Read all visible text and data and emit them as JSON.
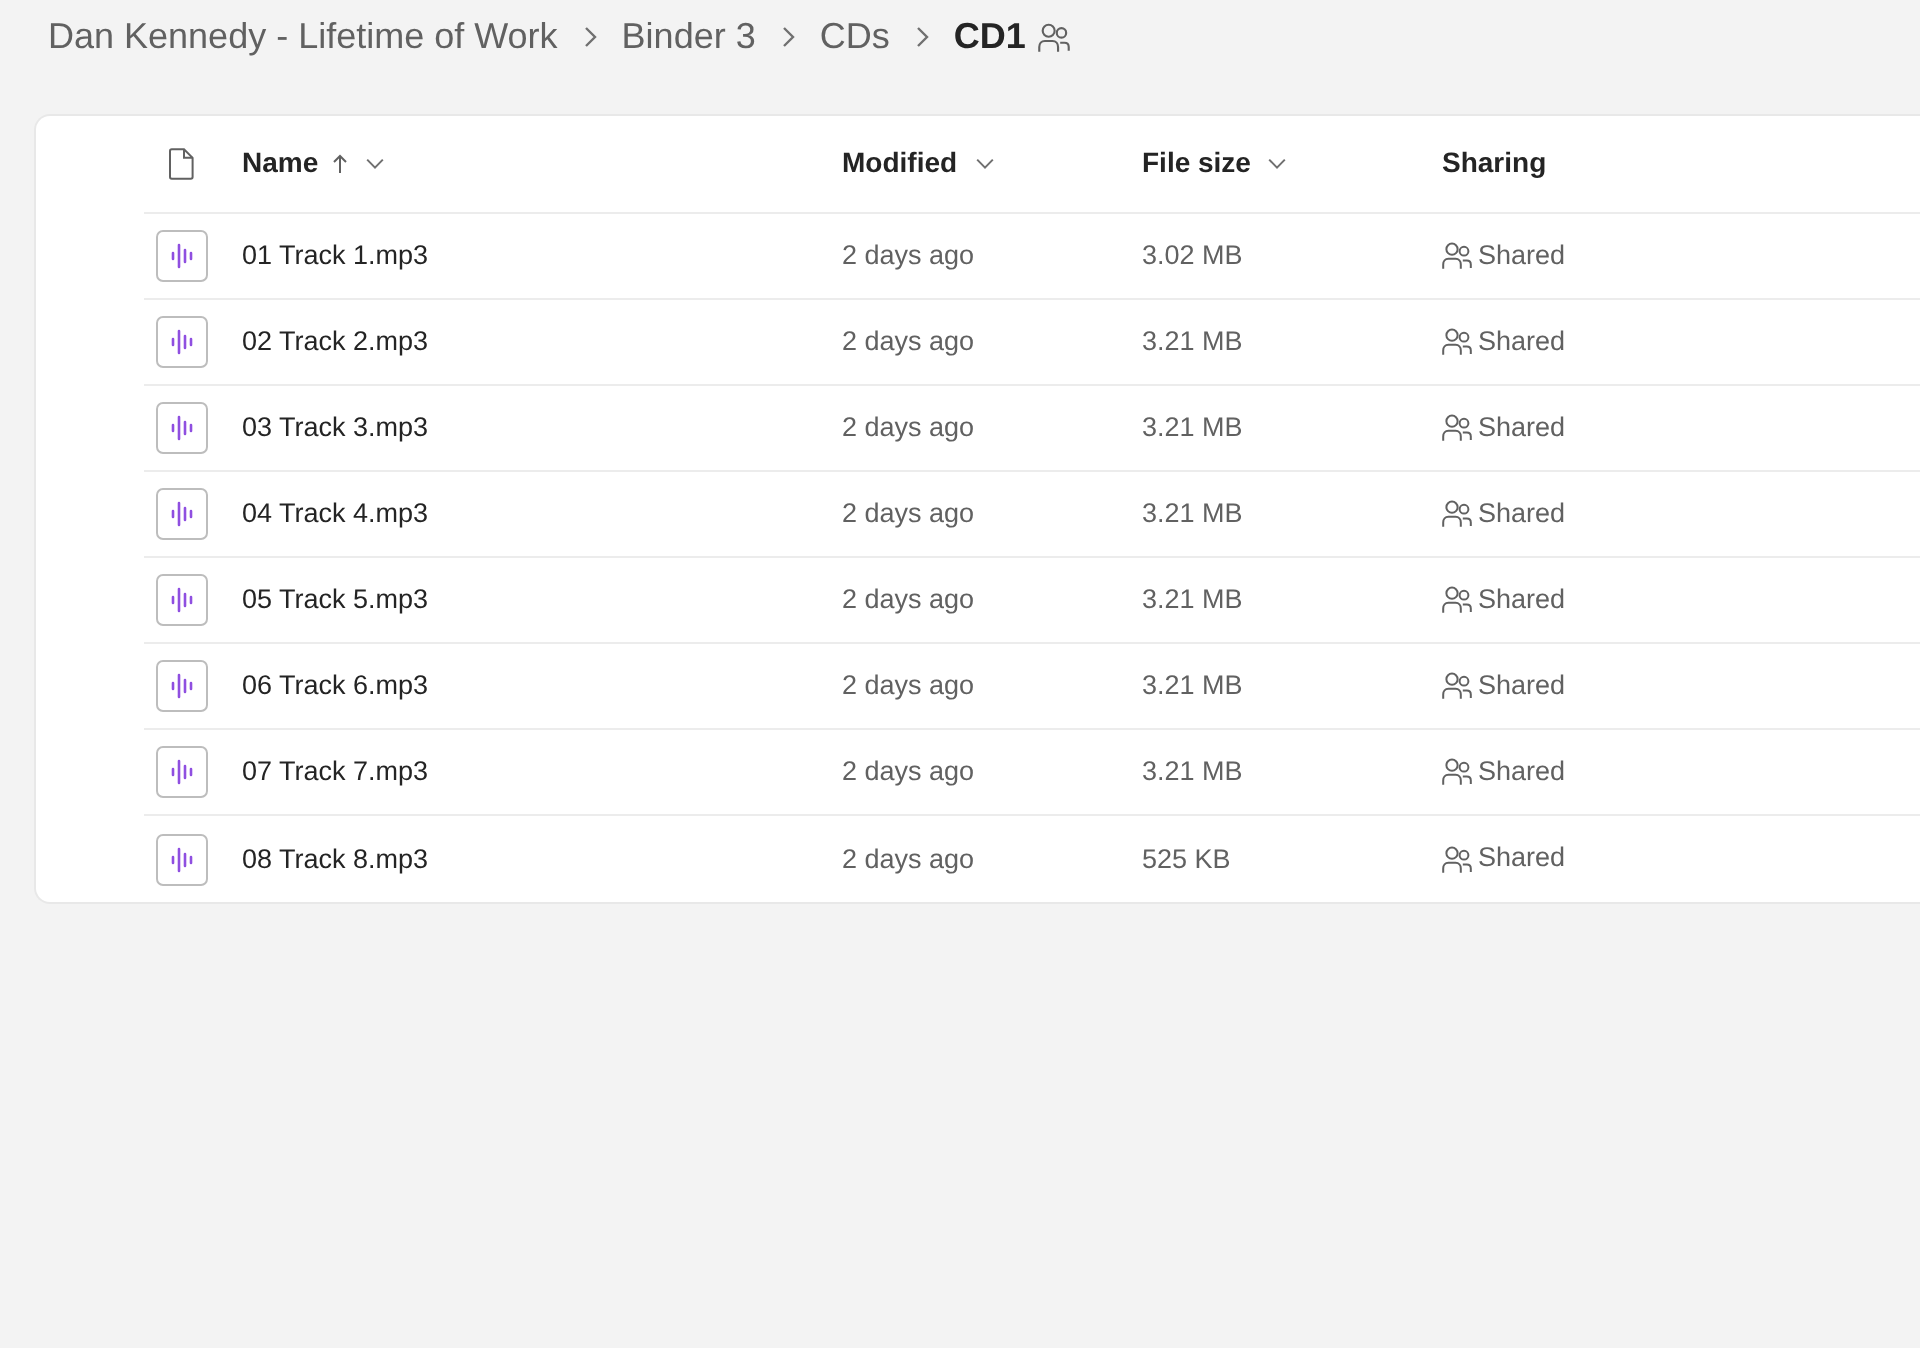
{
  "breadcrumb": [
    {
      "label": "Dan Kennedy - Lifetime of Work",
      "current": false
    },
    {
      "label": "Binder 3",
      "current": false
    },
    {
      "label": "CDs",
      "current": false
    },
    {
      "label": "CD1",
      "current": true,
      "shared": true
    }
  ],
  "columns": [
    {
      "label": "Name",
      "sorted": true,
      "menu": true
    },
    {
      "label": "Modified",
      "sorted": false,
      "menu": true
    },
    {
      "label": "File size",
      "sorted": false,
      "menu": true
    },
    {
      "label": "Sharing",
      "sorted": false,
      "menu": false
    }
  ],
  "rows": [
    {
      "name": "01 Track 1.mp3",
      "modified": "2 days ago",
      "file_size": "3.02 MB",
      "sharing": "Shared"
    },
    {
      "name": "02 Track 2.mp3",
      "modified": "2 days ago",
      "file_size": "3.21 MB",
      "sharing": "Shared"
    },
    {
      "name": "03 Track 3.mp3",
      "modified": "2 days ago",
      "file_size": "3.21 MB",
      "sharing": "Shared"
    },
    {
      "name": "04 Track 4.mp3",
      "modified": "2 days ago",
      "file_size": "3.21 MB",
      "sharing": "Shared"
    },
    {
      "name": "05 Track 5.mp3",
      "modified": "2 days ago",
      "file_size": "3.21 MB",
      "sharing": "Shared"
    },
    {
      "name": "06 Track 6.mp3",
      "modified": "2 days ago",
      "file_size": "3.21 MB",
      "sharing": "Shared"
    },
    {
      "name": "07 Track 7.mp3",
      "modified": "2 days ago",
      "file_size": "3.21 MB",
      "sharing": "Shared"
    },
    {
      "name": "08 Track 8.mp3",
      "modified": "2 days ago",
      "file_size": "525 KB",
      "sharing": "Shared"
    }
  ]
}
